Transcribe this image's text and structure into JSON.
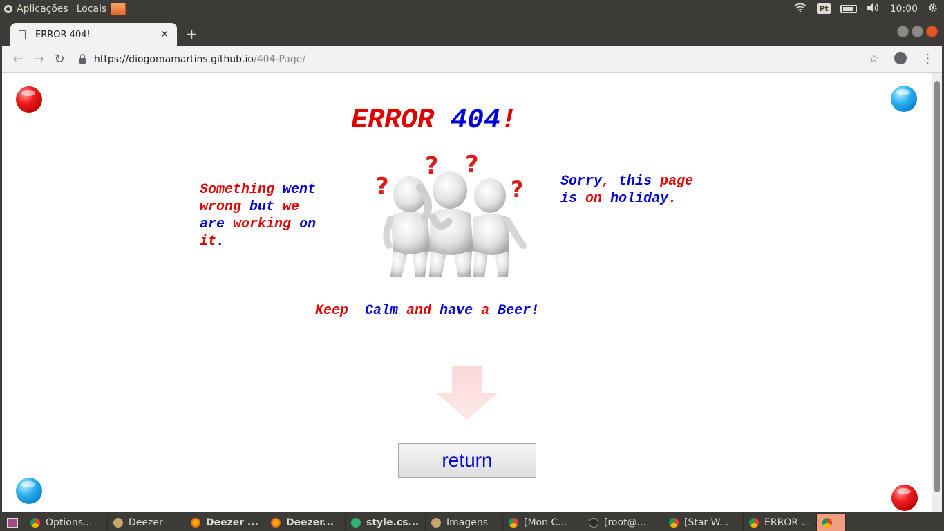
{
  "top_panel": {
    "apps_label": "Aplicações",
    "places_label": "Locais",
    "keyboard_layout": "Pt",
    "clock": "10:00"
  },
  "browser": {
    "tab_title": "ERROR 404!",
    "url_host": "https://diogomamartins.github.io",
    "url_path": "/404-Page/"
  },
  "page": {
    "title_word": "ERROR",
    "title_code": "404",
    "title_bang": "!",
    "left_message": {
      "l1a": "Something",
      "l1b": "went",
      "l2a": "wrong",
      "l2b": "but",
      "l2c": "we",
      "l3a": "are",
      "l3b": "working",
      "l3c": "on",
      "l4a": "it",
      "l4b": "."
    },
    "right_message": {
      "l1a": "Sorry",
      "l1b": ",",
      "l1c": "this",
      "l1d": "page",
      "l2a": "is",
      "l2b": "on",
      "l2c": "holiday",
      "l2d": "."
    },
    "footer_message": {
      "w1": "Keep",
      "w2": "Calm",
      "w3": "and",
      "w4": "have",
      "w5": "a",
      "w6": "Beer!"
    },
    "return_button": "return"
  },
  "taskbar": {
    "items": [
      {
        "label": "Options..."
      },
      {
        "label": "Deezer"
      },
      {
        "label": "Deezer ..."
      },
      {
        "label": "Deezer..."
      },
      {
        "label": "style.cs..."
      },
      {
        "label": "Imagens"
      },
      {
        "label": "[Mon C..."
      },
      {
        "label": "[root@..."
      },
      {
        "label": "[Star W..."
      },
      {
        "label": "ERROR ..."
      }
    ]
  },
  "colors": {
    "accent_red": "#e00000",
    "accent_blue": "#0000d6"
  }
}
